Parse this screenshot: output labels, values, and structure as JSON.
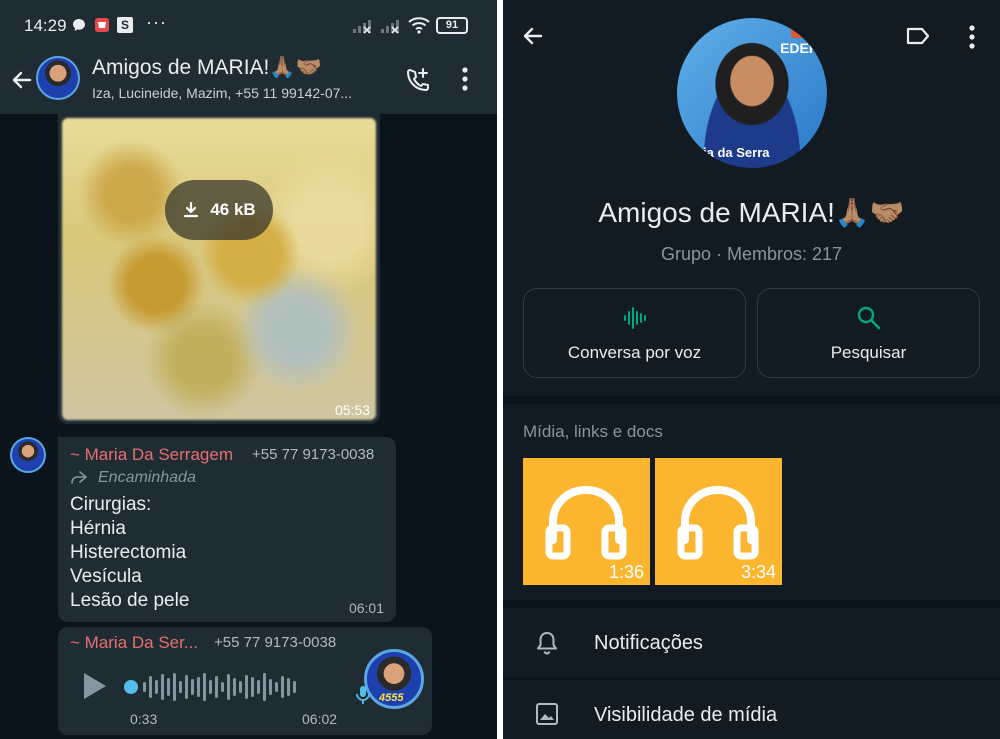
{
  "status_bar": {
    "time": "14:29",
    "battery": "91",
    "app_badge": "S",
    "more": "···"
  },
  "chat": {
    "title": "Amigos de MARIA!🙏🏽🤝🏽",
    "members": "Iza, Lucineide, Mazim, +55 11 99142-07...",
    "image_message": {
      "size_label": "46 kB",
      "time": "05:53"
    },
    "text_message": {
      "sender": "~ Maria Da Serragem",
      "phone": "+55 77 9173-0038",
      "forwarded_label": "Encaminhada",
      "lines": [
        "Cirurgias:",
        "Hérnia",
        "Histerectomia",
        "Vesícula",
        "Lesão de pele"
      ],
      "time": "06:01"
    },
    "voice_message": {
      "sender": "~ Maria Da Ser...",
      "phone": "+55 77 9173-0038",
      "elapsed": "0:33",
      "time": "06:02",
      "avatar_caption": "4555"
    }
  },
  "group_info": {
    "photo_brand": "EDER",
    "photo_caption": "ia da Serra",
    "name": "Amigos de MARIA!🙏🏽🤝🏽",
    "subtitle": "Grupo · Membros: 217",
    "actions": [
      {
        "label": "Conversa por voz",
        "icon": "voice-wave-icon"
      },
      {
        "label": "Pesquisar",
        "icon": "search-icon"
      }
    ],
    "media_title": "Mídia, links e docs",
    "media": [
      {
        "duration": "1:36",
        "icon": "headphones-icon"
      },
      {
        "duration": "3:34",
        "icon": "headphones-icon"
      }
    ],
    "settings": [
      {
        "label": "Notificações",
        "icon": "bell-icon"
      },
      {
        "label": "Visibilidade de mídia",
        "icon": "image-icon"
      }
    ]
  },
  "colors": {
    "background": "#0b141a",
    "header": "#202c33",
    "accent_green": "#00a884",
    "sender_name": "#e86f6f",
    "media_tile": "#fbb52e",
    "voice_dot": "#53bdeb"
  }
}
